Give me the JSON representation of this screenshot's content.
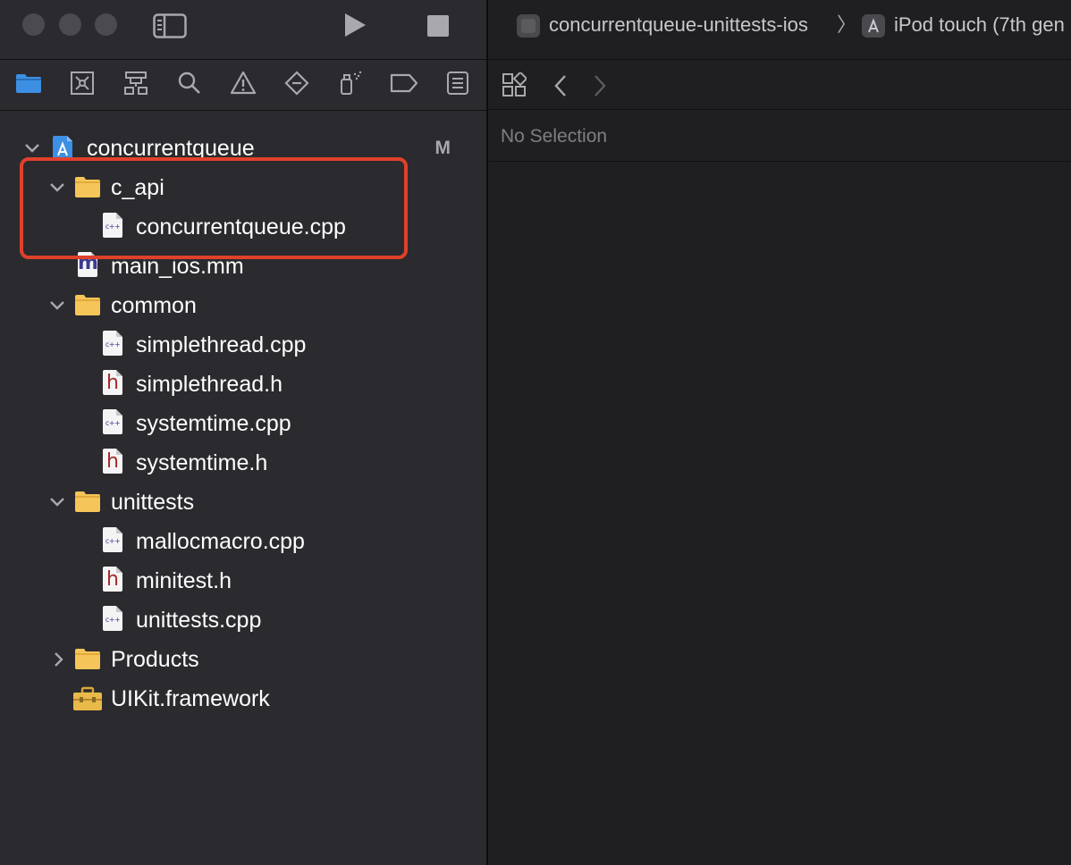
{
  "window": {
    "scheme_name": "concurrentqueue-unittests-ios",
    "breadcrumb_separator": "〉",
    "destination": "iPod touch (7th gen"
  },
  "toolbar": {
    "run_icon": "play-icon",
    "stop_icon": "stop-icon",
    "sidebar_toggle_icon": "sidebar-toggle-icon"
  },
  "navigator_tabs": [
    {
      "name": "project-navigator",
      "icon": "folder-icon",
      "active": true
    },
    {
      "name": "source-control-navigator",
      "icon": "source-control-icon"
    },
    {
      "name": "symbol-navigator",
      "icon": "hierarchy-icon"
    },
    {
      "name": "find-navigator",
      "icon": "search-icon"
    },
    {
      "name": "issue-navigator",
      "icon": "warning-icon"
    },
    {
      "name": "test-navigator",
      "icon": "diamond-icon"
    },
    {
      "name": "debug-navigator",
      "icon": "spray-icon"
    },
    {
      "name": "breakpoint-navigator",
      "icon": "breakpoint-icon"
    },
    {
      "name": "report-navigator",
      "icon": "report-icon"
    }
  ],
  "tree": {
    "project": {
      "label": "concurrentqueue",
      "status": "M"
    },
    "c_api": {
      "label": "c_api",
      "files": [
        "concurrentqueue.cpp"
      ]
    },
    "main_ios": {
      "label": "main_ios.mm"
    },
    "common": {
      "label": "common",
      "files": [
        "simplethread.cpp",
        "simplethread.h",
        "systemtime.cpp",
        "systemtime.h"
      ]
    },
    "unittests": {
      "label": "unittests",
      "files": [
        "mallocmacro.cpp",
        "minitest.h",
        "unittests.cpp"
      ]
    },
    "products": {
      "label": "Products"
    },
    "uikit": {
      "label": "UIKit.framework"
    }
  },
  "editor": {
    "no_selection": "No Selection"
  },
  "colors": {
    "accent_blue": "#3d8fe3",
    "folder_yellow": "#f6c559",
    "highlight_red": "#e0412b"
  }
}
